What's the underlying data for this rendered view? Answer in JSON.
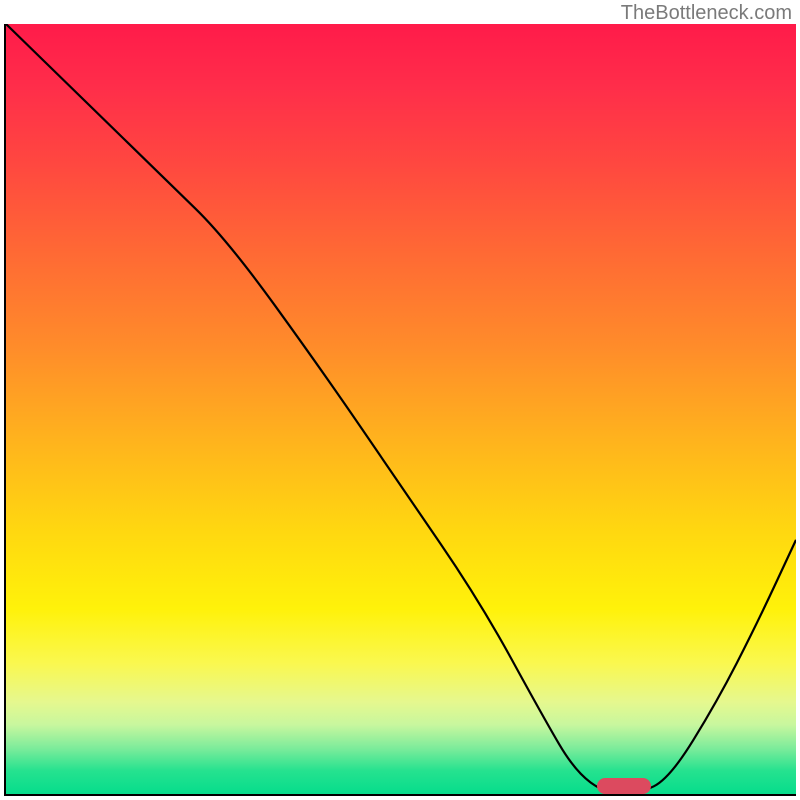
{
  "watermark": "TheBottleneck.com",
  "chart_data": {
    "type": "line",
    "title": "",
    "xlabel": "",
    "ylabel": "",
    "xlim": [
      0,
      100
    ],
    "ylim": [
      0,
      100
    ],
    "series": [
      {
        "name": "bottleneck-curve",
        "x": [
          0,
          10,
          20,
          28,
          40,
          50,
          60,
          68,
          72,
          76,
          80,
          84,
          90,
          95,
          100
        ],
        "values": [
          100,
          90,
          80,
          72,
          55,
          40,
          25,
          10,
          3,
          0,
          0,
          2,
          12,
          22,
          33
        ]
      }
    ],
    "marker": {
      "x_center": 78,
      "y": 0,
      "width_pct": 6.8
    },
    "background_gradient": {
      "stops": [
        {
          "pct": 0,
          "color": "#ff1b4a"
        },
        {
          "pct": 18,
          "color": "#ff4740"
        },
        {
          "pct": 42,
          "color": "#ff8c2a"
        },
        {
          "pct": 66,
          "color": "#fff20a"
        },
        {
          "pct": 88,
          "color": "#e6f88e"
        },
        {
          "pct": 100,
          "color": "#06dd8c"
        }
      ]
    }
  }
}
